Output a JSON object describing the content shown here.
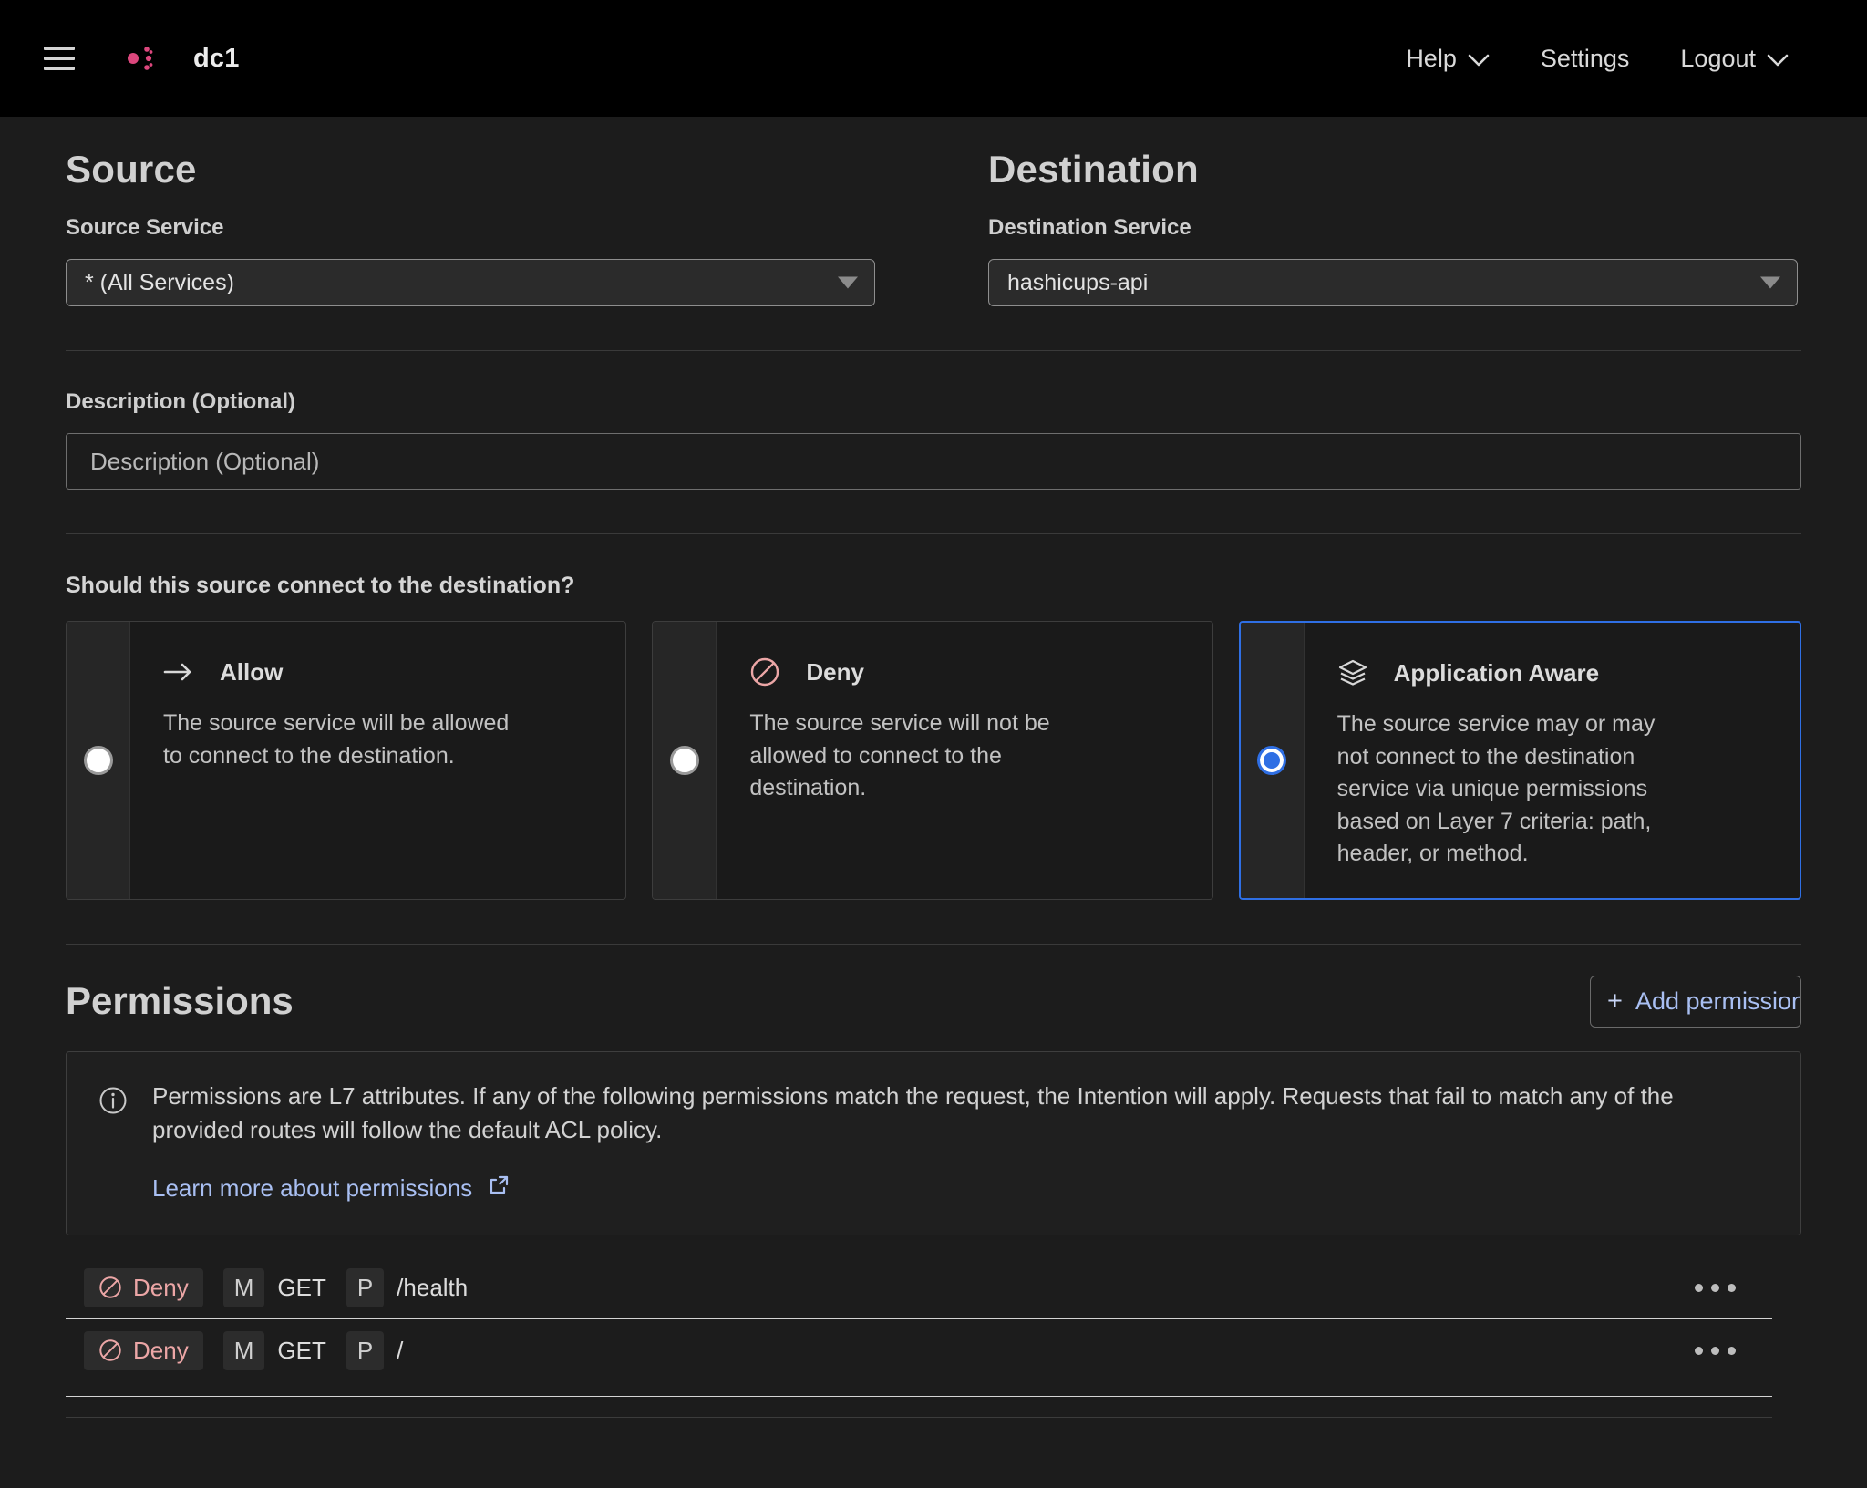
{
  "header": {
    "menu_icon": "hamburger-icon",
    "logo_icon": "consul-logo-icon",
    "datacenter": "dc1",
    "nav": [
      {
        "label": "Help",
        "has_caret": true
      },
      {
        "label": "Settings",
        "has_caret": false
      },
      {
        "label": "Logout",
        "has_caret": true
      }
    ]
  },
  "source": {
    "title": "Source",
    "field_label": "Source Service",
    "selected": "* (All Services)"
  },
  "destination": {
    "title": "Destination",
    "field_label": "Destination Service",
    "selected": "hashicups-api"
  },
  "description": {
    "label": "Description (Optional)",
    "value": "",
    "placeholder": "Description (Optional)"
  },
  "connect_question": {
    "label": "Should this source connect to the destination?",
    "options": [
      {
        "id": "allow",
        "icon": "arrow-right-icon",
        "title": "Allow",
        "description": "The source service will be allowed to connect to the destination.",
        "selected": false
      },
      {
        "id": "deny",
        "icon": "deny-circle-slash-icon",
        "title": "Deny",
        "description": "The source service will not be allowed to connect to the destination.",
        "selected": false
      },
      {
        "id": "app-aware",
        "icon": "layers-icon",
        "title": "Application Aware",
        "description": "The source service may or may not connect to the destination service via unique permissions based on Layer 7 criteria: path, header, or method.",
        "selected": true
      }
    ]
  },
  "permissions": {
    "title": "Permissions",
    "add_button": {
      "plus": "+",
      "label": "Add permission",
      "icon": "plus-icon"
    },
    "info": {
      "icon": "info-circle-icon",
      "text": "Permissions are L7 attributes. If any of the following permissions match the request, the Intention will apply. Requests that fail to match any of the provided routes will follow the default ACL policy.",
      "link_label": "Learn more about permissions",
      "link_icon": "external-link-icon"
    },
    "rows": [
      {
        "action": "Deny",
        "action_icon": "deny-circle-slash-icon",
        "method_key": "M",
        "method_value": "GET",
        "path_key": "P",
        "path_value": "/health",
        "menu_icon": "more-horizontal-icon"
      },
      {
        "action": "Deny",
        "action_icon": "deny-circle-slash-icon",
        "method_key": "M",
        "method_value": "GET",
        "path_key": "P",
        "path_value": "/",
        "menu_icon": "more-horizontal-icon"
      }
    ]
  },
  "colors": {
    "brand_pink": "#dc477d",
    "accent_blue": "#2f6fe4",
    "link_blue": "#a9bff2",
    "deny_red": "#eca6a6",
    "page_bg": "#1c1c1c",
    "nav_bg": "#000000"
  }
}
